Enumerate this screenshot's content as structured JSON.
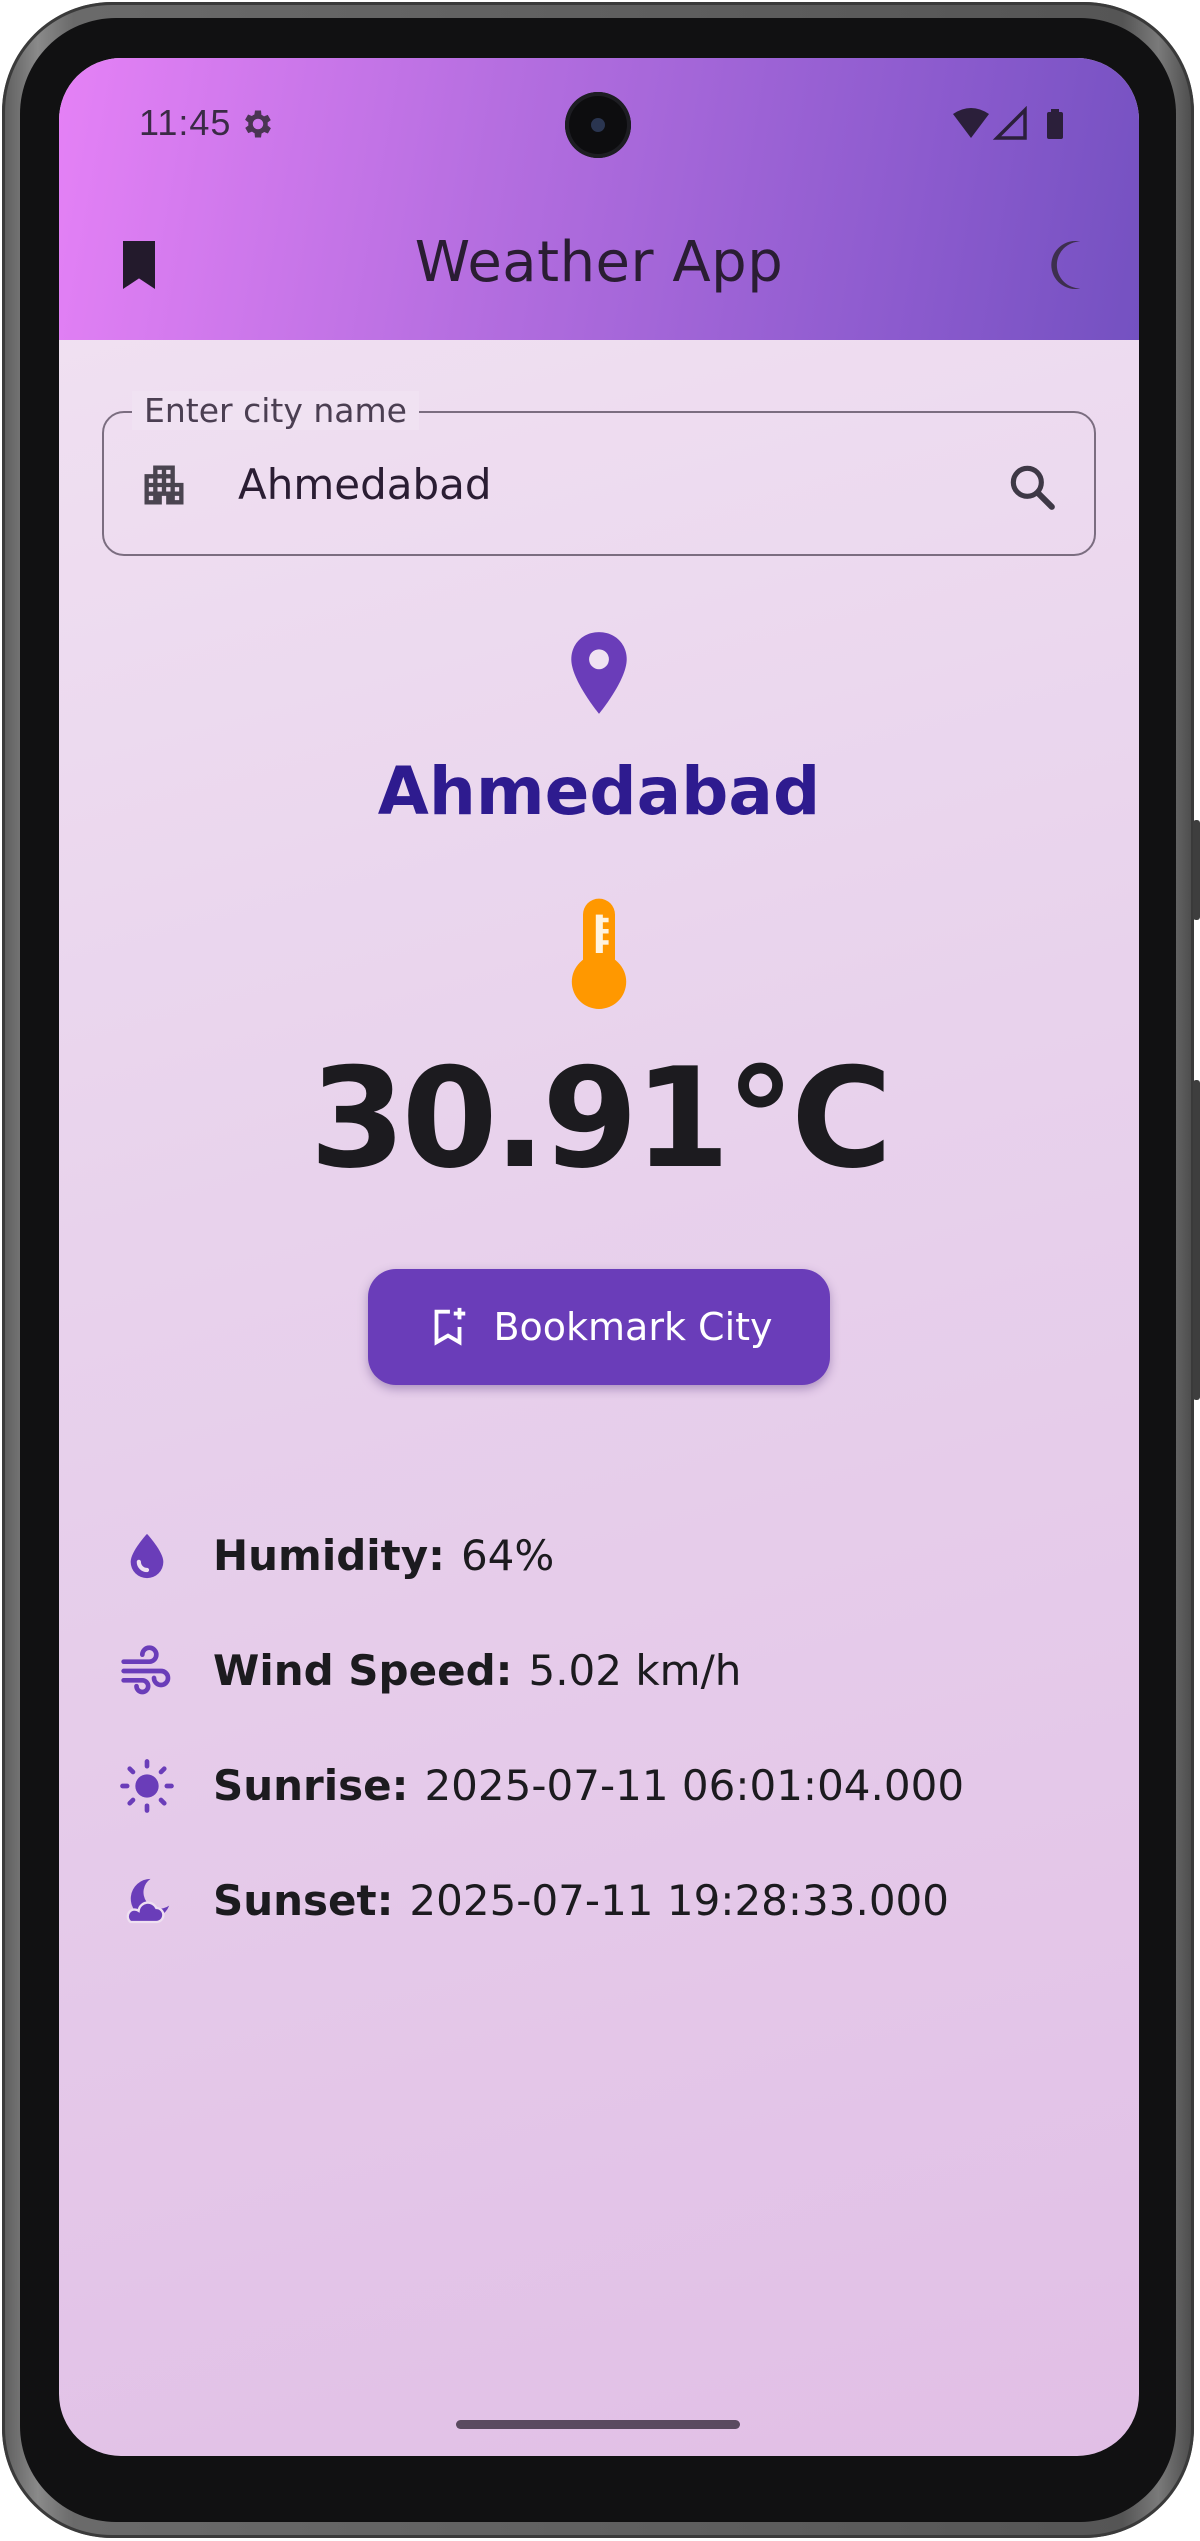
{
  "status_bar": {
    "time": "11:45",
    "icons": [
      "settings-icon",
      "wifi-icon",
      "signal-icon",
      "battery-icon"
    ]
  },
  "app_bar": {
    "title": "Weather App",
    "left_action_icon": "bookmark-icon",
    "right_action_icon": "moon-icon"
  },
  "search": {
    "label": "Enter city name",
    "value": "Ahmedabad",
    "prefix_icon": "apartment-icon",
    "suffix_icon": "search-icon"
  },
  "weather": {
    "location_icon": "location-pin-icon",
    "city": "Ahmedabad",
    "temperature_icon": "thermometer-icon",
    "temperature": "30.91°C",
    "bookmark_button_label": "Bookmark City"
  },
  "details": [
    {
      "icon": "water-drop-icon",
      "label": "Humidity:",
      "value": "64%"
    },
    {
      "icon": "wind-icon",
      "label": "Wind Speed:",
      "value": "5.02 km/h"
    },
    {
      "icon": "sun-icon",
      "label": "Sunrise:",
      "value": "2025-07-11 06:01:04.000"
    },
    {
      "icon": "night-icon",
      "label": "Sunset:",
      "value": "2025-07-11 19:28:33.000"
    }
  ],
  "colors": {
    "primary": "#6a3db9",
    "city_text": "#2e1b8f",
    "thermometer": "#ff9800",
    "appbar_gradient_start": "#e581f6",
    "appbar_gradient_end": "#7451c1"
  }
}
